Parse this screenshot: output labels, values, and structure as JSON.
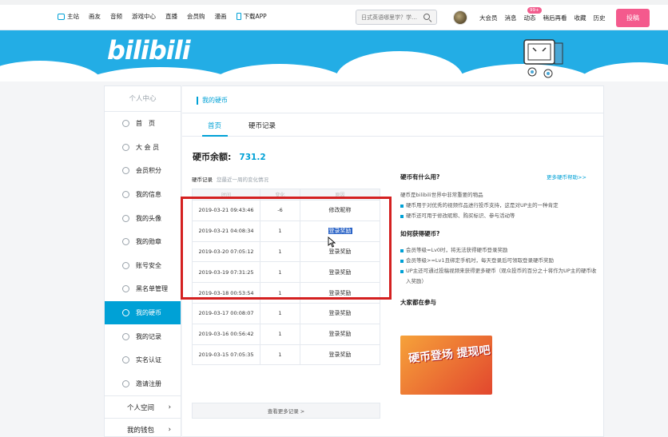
{
  "nav": {
    "items": [
      "主站",
      "画友",
      "音频",
      "游戏中心",
      "直播",
      "会员购",
      "漫画",
      "下载APP"
    ],
    "search_placeholder": "日式英语哪里学？学…",
    "right_items": [
      "大会员",
      "消息",
      "动态",
      "稍后再看",
      "收藏",
      "历史"
    ],
    "badge": "99+",
    "upload": "投稿"
  },
  "banner": {
    "logo": "bilibili"
  },
  "sidebar": {
    "header": "个人中心",
    "items": [
      "首　页",
      "大 会 员",
      "会员积分",
      "我的信息",
      "我的头像",
      "我的勋章",
      "账号安全",
      "黑名单管理",
      "我的硬币",
      "我的记录",
      "实名认证",
      "邀请注册"
    ],
    "active_index": 8,
    "sub_items": [
      "个人空间",
      "我的钱包"
    ]
  },
  "main": {
    "title": "我的硬币",
    "tabs": [
      "首页",
      "硬币记录"
    ],
    "balance_label": "硬币余额:",
    "balance_value": "731.2",
    "records_label": "硬币记录",
    "records_sub": "您最近一周的变化情况",
    "table_headers": [
      "时间",
      "变化",
      "原因"
    ],
    "rows": [
      [
        "2019-03-21 09:43:46",
        "-6",
        "修改昵称"
      ],
      [
        "2019-03-21 04:08:34",
        "1",
        "登录奖励"
      ],
      [
        "2019-03-20 07:05:12",
        "1",
        "登录奖励"
      ],
      [
        "2019-03-19 07:31:25",
        "1",
        "登录奖励"
      ],
      [
        "2019-03-18 00:53:54",
        "1",
        "登录奖励"
      ],
      [
        "2019-03-17 00:08:07",
        "1",
        "登录奖励"
      ],
      [
        "2019-03-16 00:56:42",
        "1",
        "登录奖励"
      ],
      [
        "2019-03-15 07:05:35",
        "1",
        "登录奖励"
      ]
    ],
    "more_records": "查看更多记录 >"
  },
  "info": {
    "q1": "硬币有什么用?",
    "more_help": "更多硬币帮助>>",
    "q1_lines": [
      "硬币是bilibili世界中非常重要的物品",
      "硬币用于对优秀的视频作品进行投币支持，这是对UP主的一种肯定",
      "硬币还可用于修改昵称、购买标识、参与活动等"
    ],
    "q2": "如何获得硬币?",
    "q2_lines": [
      "会员等级=Lv0时，将无法获得硬币登录奖励",
      "会员等级>=Lv1且绑定手机时，每天登录后可领取登录硬币奖励",
      "UP主还可通过投稿视频来获得更多硬币（观众投币的百分之十将作为UP主的硬币收入奖励）"
    ],
    "q3": "大家都在参与",
    "promo_text": "硬币登场 提现吧"
  }
}
